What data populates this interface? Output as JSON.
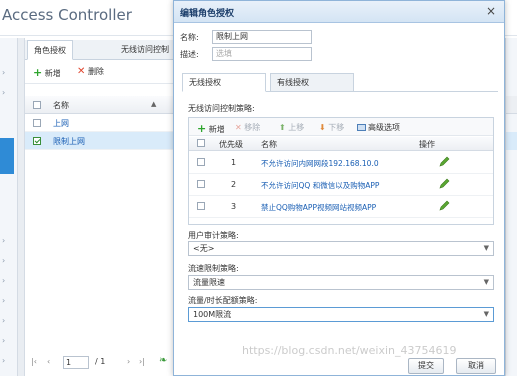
{
  "app": {
    "title": "Access Controller"
  },
  "panel": {
    "tabs": [
      "角色授权",
      "无线访问控制"
    ],
    "toolbar": {
      "add": "新增",
      "delete": "删除"
    },
    "grid": {
      "header": "名称",
      "rows": [
        {
          "name": "上网",
          "checked": false,
          "selected": false
        },
        {
          "name": "限制上网",
          "checked": true,
          "selected": true
        }
      ]
    },
    "pager": {
      "page": "1",
      "total": "/ 1"
    }
  },
  "modal": {
    "title": "编辑角色授权",
    "close": "×",
    "name_label": "名称:",
    "name_value": "限制上网",
    "desc_label": "描述:",
    "desc_placeholder": "选填",
    "tabs": [
      "无线授权",
      "有线授权"
    ],
    "wireless_section_label": "无线访问控制策略:",
    "inner_toolbar": {
      "add": "新增",
      "remove": "移除",
      "up": "上移",
      "down": "下移",
      "advanced": "高级选项"
    },
    "inner_headers": {
      "priority": "优先级",
      "name": "名称",
      "action": "操作"
    },
    "policies": [
      {
        "priority": "1",
        "name": "不允许访问内网网段192.168.10.0"
      },
      {
        "priority": "2",
        "name": "不允许访问QQ 和微信以及购物APP"
      },
      {
        "priority": "3",
        "name": "禁止QQ购物APP视频网站视频APP"
      }
    ],
    "audit_label": "用户审计策略:",
    "audit_value": "<无>",
    "flow_label": "流速限制策略:",
    "flow_value": "流量限速",
    "quota_label": "流量/时长配额策略:",
    "quota_value": "100M限流",
    "submit": "提交",
    "cancel": "取消"
  },
  "watermark": "https://blog.csdn.net/weixin_43754619",
  "colors": {
    "accent": "#2f8bd6",
    "link": "#1a5fb4",
    "add": "#2ea52e",
    "delete": "#e0452e",
    "modal_header": "#d4e4f4"
  }
}
